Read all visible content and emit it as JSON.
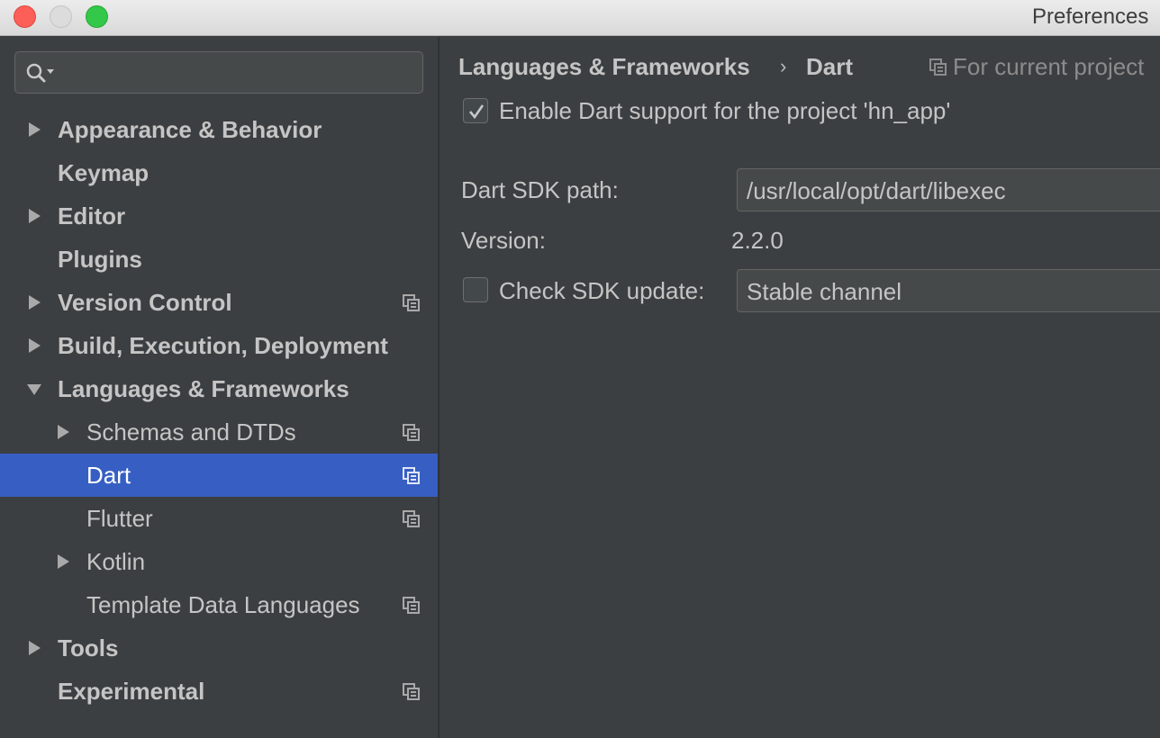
{
  "window": {
    "title": "Preferences"
  },
  "search": {
    "placeholder": "",
    "value": ""
  },
  "tree": [
    {
      "label": "Appearance & Behavior",
      "bold": true,
      "arrow": "right",
      "project": false
    },
    {
      "label": "Keymap",
      "bold": true,
      "arrow": "none",
      "project": false
    },
    {
      "label": "Editor",
      "bold": true,
      "arrow": "right",
      "project": false
    },
    {
      "label": "Plugins",
      "bold": true,
      "arrow": "none",
      "project": false
    },
    {
      "label": "Version Control",
      "bold": true,
      "arrow": "right",
      "project": true
    },
    {
      "label": "Build, Execution, Deployment",
      "bold": true,
      "arrow": "right",
      "project": false
    },
    {
      "label": "Languages & Frameworks",
      "bold": true,
      "arrow": "down",
      "project": false
    },
    {
      "label": "Schemas and DTDs",
      "bold": false,
      "arrow": "right",
      "project": true
    },
    {
      "label": "Dart",
      "bold": false,
      "arrow": "none",
      "project": true,
      "selected": true
    },
    {
      "label": "Flutter",
      "bold": false,
      "arrow": "none",
      "project": true
    },
    {
      "label": "Kotlin",
      "bold": false,
      "arrow": "right",
      "project": false
    },
    {
      "label": "Template Data Languages",
      "bold": false,
      "arrow": "none",
      "project": true
    },
    {
      "label": "Tools",
      "bold": true,
      "arrow": "right",
      "project": false
    },
    {
      "label": "Experimental",
      "bold": true,
      "arrow": "none",
      "project": true
    }
  ],
  "content": {
    "breadcrumb": [
      "Languages & Frameworks",
      "Dart"
    ],
    "breadcrumb_separator": "›",
    "scope_label": "For current project",
    "enable_dart": {
      "label": "Enable Dart support for the project 'hn_app'",
      "checked": true
    },
    "sdk_path": {
      "label": "Dart SDK path:",
      "value": "/usr/local/opt/dart/libexec"
    },
    "version": {
      "label": "Version:",
      "value": "2.2.0"
    },
    "check_update": {
      "label": "Check SDK update:",
      "checked": false,
      "channel": "Stable channel"
    }
  },
  "colors": {
    "background": "#3c3f41",
    "selection": "#375fc3",
    "text": "#c5c5c5"
  }
}
